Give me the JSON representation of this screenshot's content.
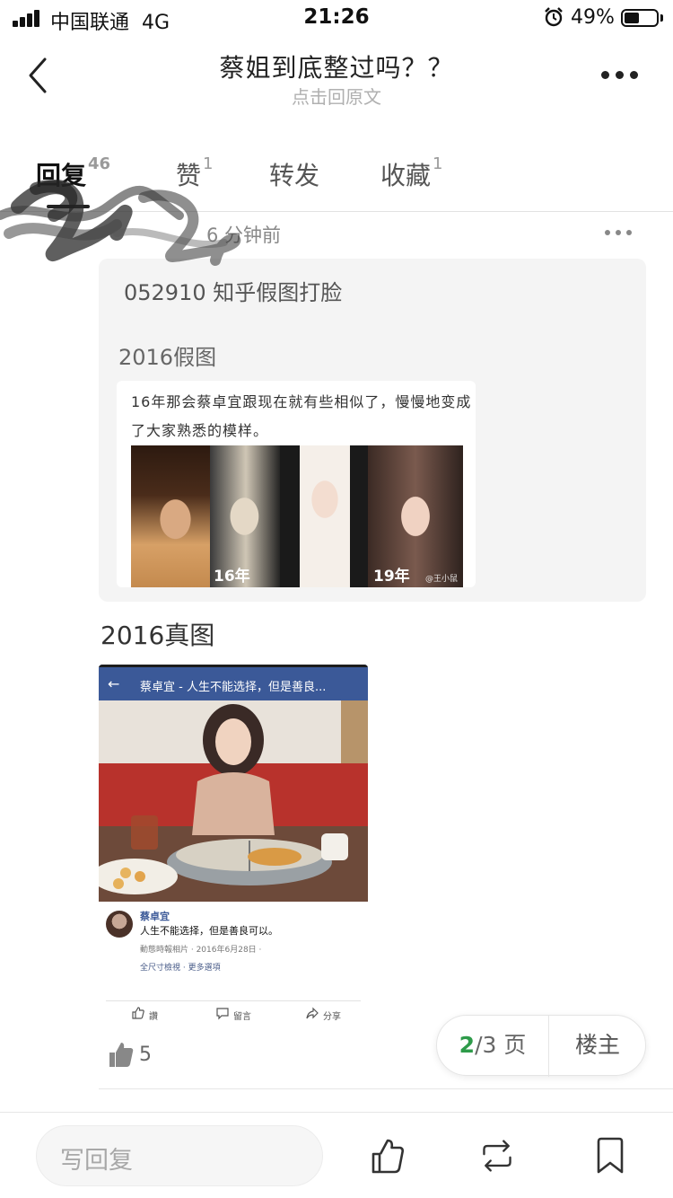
{
  "status_bar": {
    "carrier": "中国联通",
    "network": "4G",
    "time": "21:26",
    "battery": "49%"
  },
  "nav": {
    "title": "蔡姐到底整过吗？？",
    "subtitle": "点击回原文"
  },
  "tabs": [
    {
      "label": "回复",
      "count": "46",
      "active": true
    },
    {
      "label": "赞",
      "count": "1",
      "active": false
    },
    {
      "label": "转发",
      "count": "",
      "active": false
    },
    {
      "label": "收藏",
      "count": "1",
      "active": false
    }
  ],
  "reply": {
    "time_ago": "6 分钟前",
    "quote_title": "052910 知乎假图打脸",
    "quote_fake_label": "2016假图",
    "card_text": "16年那会蔡卓宜跟现在就有些相似了，慢慢地变成了大家熟悉的模样。",
    "face_labels": [
      "16年",
      "19年"
    ],
    "card_watermark": "@王小鼠",
    "real_label": "2016真图",
    "fb": {
      "header_title": "蔡卓宜 - 人生不能选择，但是善良...",
      "poster_name": "蔡卓宜",
      "post_text": "人生不能选择，但是善良可以。",
      "post_meta": "動態時報相片 · 2016年6月28日 · ",
      "post_links": "全尺寸檢視 · 更多選項",
      "actions": [
        "讚",
        "留言",
        "分享"
      ]
    },
    "like_count": "5"
  },
  "pager": {
    "current": "2",
    "total": "/3 页",
    "owner_label": "楼主"
  },
  "bottom": {
    "compose_placeholder": "写回复"
  },
  "colors": {
    "accent_green": "#2e9b4a",
    "facebook_blue": "#3b5998"
  }
}
